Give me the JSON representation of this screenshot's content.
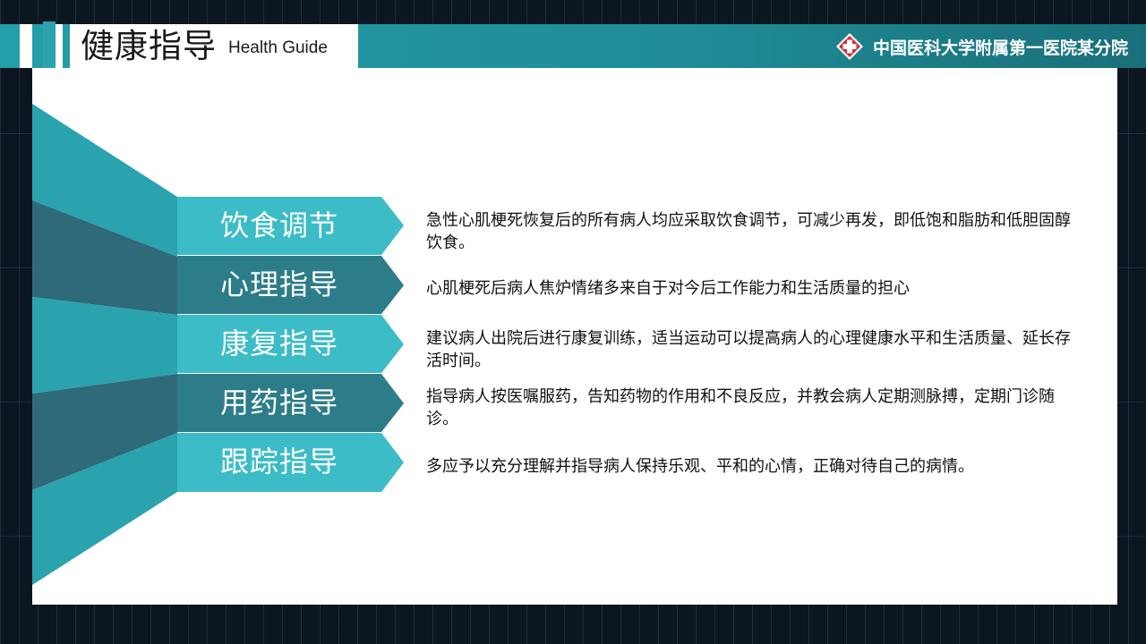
{
  "header": {
    "title": "健康指导",
    "subtitle": "Health Guide",
    "hospital_name": "中国医科大学附属第一医院某分院",
    "logo_icon": "red-cross-icon"
  },
  "colors": {
    "teal_light": "#3bbcc7",
    "teal_dark": "#2d7c8a",
    "funnel_light": "#2aa3ae",
    "funnel_dark": "#2e6a7a",
    "logo_red": "#d52b35"
  },
  "items": [
    {
      "label": "饮食调节",
      "desc": "急性心肌梗死恢复后的所有病人均应采取饮食调节，可减少再发，即低饱和脂肪和低胆固醇饮食。"
    },
    {
      "label": "心理指导",
      "desc": "心肌梗死后病人焦炉情绪多来自于对今后工作能力和生活质量的担心"
    },
    {
      "label": "康复指导",
      "desc": "建议病人出院后进行康复训练，适当运动可以提高病人的心理健康水平和生活质量、延长存活时间。"
    },
    {
      "label": "用药指导",
      "desc": "指导病人按医嘱服药，告知药物的作用和不良反应，并教会病人定期测脉搏，定期门诊随诊。"
    },
    {
      "label": "跟踪指导",
      "desc": "多应予以充分理解并指导病人保持乐观、平和的心情，正确对待自己的病情。"
    }
  ]
}
